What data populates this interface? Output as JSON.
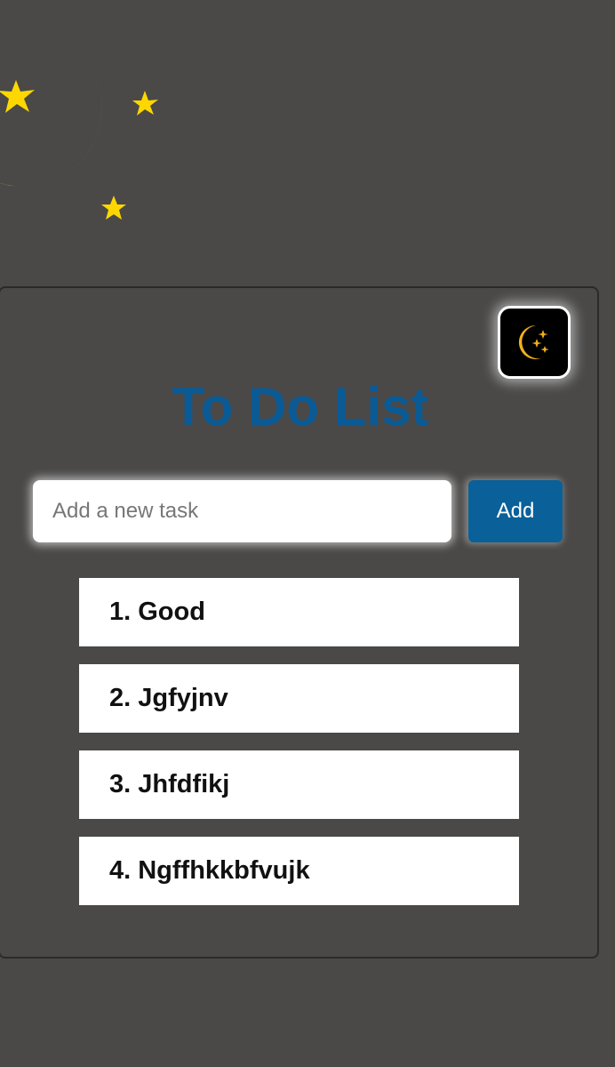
{
  "header": {
    "decor_icon": "moon-and-stars-icon",
    "toggle_icon": "moon-stars-icon",
    "title": "To Do List"
  },
  "input": {
    "placeholder": "Add a new task",
    "value": ""
  },
  "add_button": {
    "label": "Add"
  },
  "tasks": [
    {
      "label": "1. Good"
    },
    {
      "label": "2. Jgfyjnv"
    },
    {
      "label": "3. Jhfdfikj"
    },
    {
      "label": "4. Ngffhkkbfvujk"
    }
  ],
  "colors": {
    "background": "#4a4948",
    "title": "#0a5a96",
    "button": "#0a6098",
    "moon": "#ffd700",
    "task_bg": "#ffffff"
  }
}
